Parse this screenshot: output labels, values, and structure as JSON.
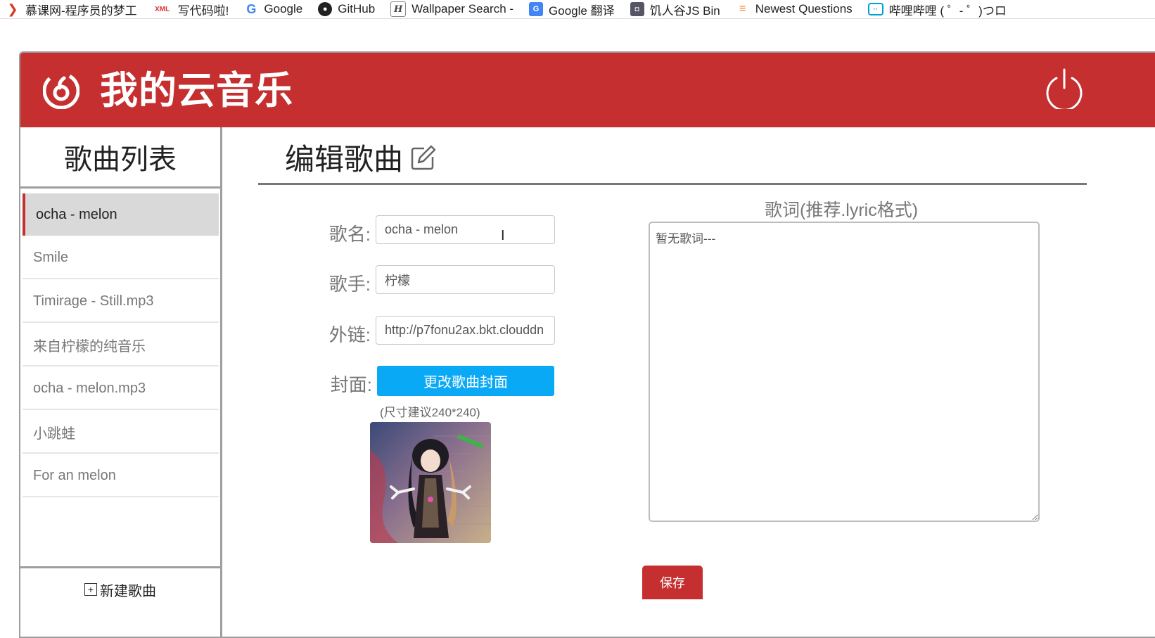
{
  "bookmarks": [
    {
      "icon": "imooc-icon",
      "label": "慕课网-程序员的梦工"
    },
    {
      "icon": "xml-icon",
      "label": "写代码啦!"
    },
    {
      "icon": "google-icon",
      "label": "Google"
    },
    {
      "icon": "github-icon",
      "label": "GitHub"
    },
    {
      "icon": "wallpaper-icon",
      "label": "Wallpaper Search -"
    },
    {
      "icon": "google-translate-icon",
      "label": "Google 翻译"
    },
    {
      "icon": "jsbin-icon",
      "label": "饥人谷JS Bin"
    },
    {
      "icon": "stackoverflow-icon",
      "label": "Newest Questions"
    },
    {
      "icon": "bilibili-icon",
      "label": "哔哩哔哩 ( ゜- ゜)つロ"
    }
  ],
  "header": {
    "title": "我的云音乐",
    "accent_color": "#c62f2f"
  },
  "sidebar": {
    "title": "歌曲列表",
    "songs": [
      {
        "label": "ocha - melon",
        "active": true
      },
      {
        "label": "Smile"
      },
      {
        "label": "Timirage - Still.mp3"
      },
      {
        "label": "来自柠檬的纯音乐"
      },
      {
        "label": "ocha - melon.mp3"
      },
      {
        "label": "小跳蛙"
      },
      {
        "label": "For an melon"
      }
    ],
    "new_song_label": "新建歌曲"
  },
  "editor": {
    "title": "编辑歌曲",
    "fields": {
      "name_label": "歌名:",
      "name_value": "ocha - melon",
      "singer_label": "歌手:",
      "singer_value": "柠檬",
      "url_label": "外链:",
      "url_value": "http://p7fonu2ax.bkt.clouddn",
      "cover_label": "封面:"
    },
    "cover_button": "更改歌曲封面",
    "cover_hint": "(尺寸建议240*240)",
    "lyrics_label": "歌词(推荐.lyric格式)",
    "lyrics_value": "暂无歌词---",
    "save_button": "保存",
    "cover_button_color": "#0aa9f5"
  }
}
